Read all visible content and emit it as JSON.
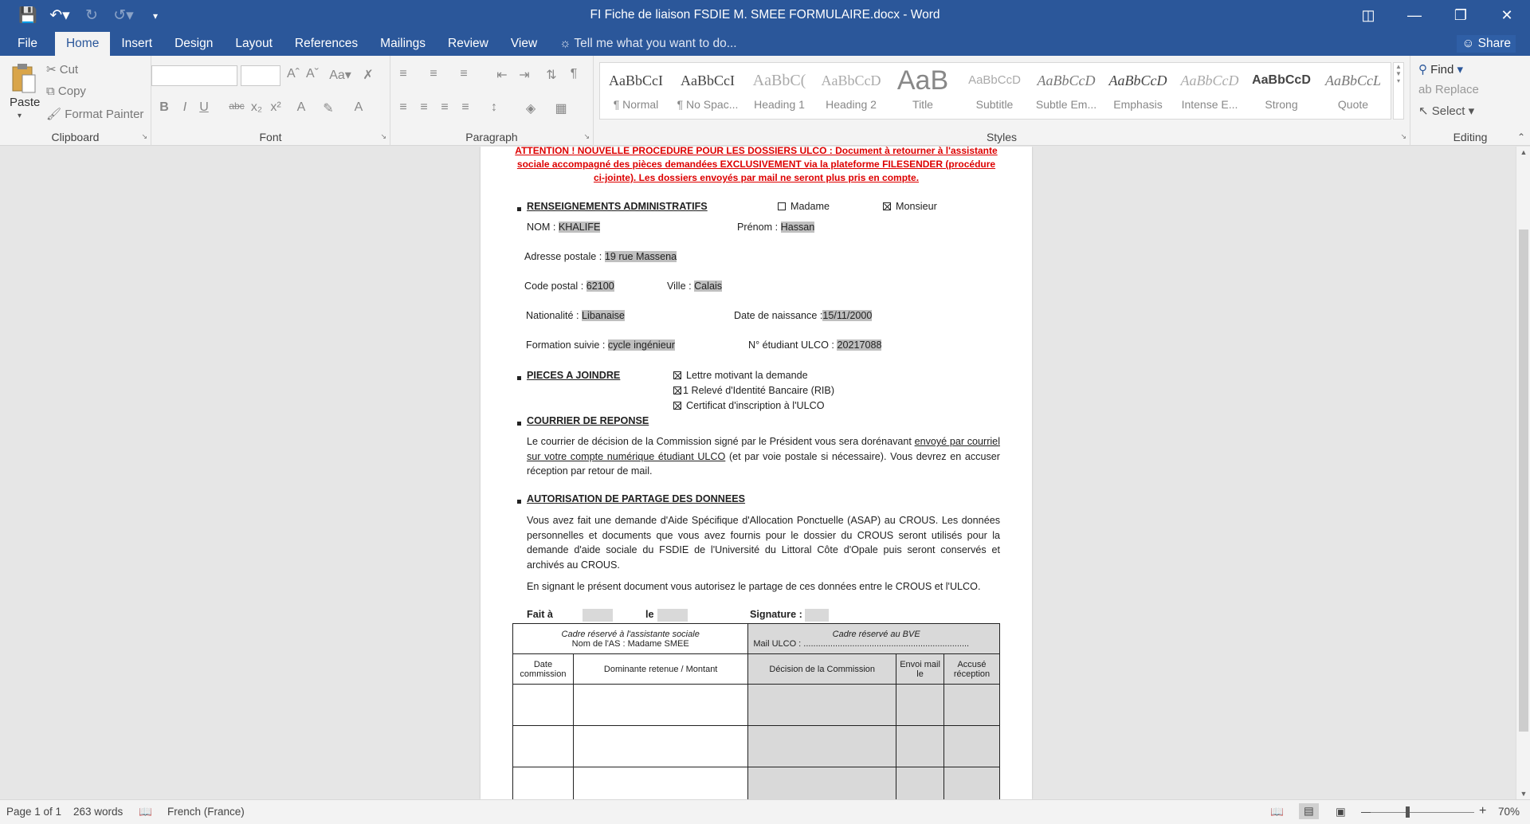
{
  "qat": {
    "save_icon": "save-icon",
    "undo_icon": "undo-icon",
    "redo_icon": "redo-icon",
    "customize_icon": "customize-qat-icon"
  },
  "window": {
    "title": "FI Fiche de liaison FSDIE M. SMEE FORMULAIRE.docx - Word"
  },
  "tabs": [
    "File",
    "Home",
    "Insert",
    "Design",
    "Layout",
    "References",
    "Mailings",
    "Review",
    "View"
  ],
  "active_tab": "Home",
  "tellme": "Tell me what you want to do...",
  "share": "Share",
  "clipboard": {
    "paste": "Paste",
    "cut": "Cut",
    "copy": "Copy",
    "format_painter": "Format Painter",
    "label": "Clipboard"
  },
  "font": {
    "label": "Font"
  },
  "paragraph": {
    "label": "Paragraph"
  },
  "styles": {
    "label": "Styles",
    "items": [
      {
        "preview": "AaBbCcI",
        "name": "¶ Normal"
      },
      {
        "preview": "AaBbCcI",
        "name": "¶ No Spac..."
      },
      {
        "preview": "AaBbC(",
        "name": "Heading 1"
      },
      {
        "preview": "AaBbCcD",
        "name": "Heading 2"
      },
      {
        "preview": "AaB",
        "name": "Title"
      },
      {
        "preview": "AaBbCcD",
        "name": "Subtitle"
      },
      {
        "preview": "AaBbCcD",
        "name": "Subtle Em..."
      },
      {
        "preview": "AaBbCcD",
        "name": "Emphasis"
      },
      {
        "preview": "AaBbCcD",
        "name": "Intense E..."
      },
      {
        "preview": "AaBbCcD",
        "name": "Strong"
      },
      {
        "preview": "AaBbCcL",
        "name": "Quote"
      }
    ]
  },
  "editing": {
    "find": "Find",
    "replace": "Replace",
    "select": "Select",
    "label": "Editing"
  },
  "doc": {
    "attention": "ATTENTION ! NOUVELLE PROCEDURE POUR LES DOSSIERS ULCO : Document à retourner à l'assistante sociale accompagné des pièces demandées EXCLUSIVEMENT via la plateforme FILESENDER (procédure ci-jointe). Les dossiers envoyés par mail ne seront plus pris en compte.",
    "sec1": "RENSEIGNEMENTS ADMINISTRATIFS",
    "madame": "Madame",
    "monsieur": "Monsieur",
    "nom_label": "NOM : ",
    "nom": "KHALIFE",
    "prenom_label": "Prénom : ",
    "prenom": "Hassan",
    "adresse_label": "Adresse postale : ",
    "adresse": "19 rue Massena",
    "cp_label": "Code postal : ",
    "cp": "62100",
    "ville_label": "Ville : ",
    "ville": "Calais",
    "nat_label": "Nationalité : ",
    "nat": "Libanaise",
    "dob_label": "Date de naissance :",
    "dob": "15/11/2000",
    "formation_label": "Formation suivie : ",
    "formation": "cycle ingénieur",
    "etudiant_label": "N° étudiant ULCO : ",
    "etudiant": "20217088",
    "sec2": "PIECES A JOINDRE",
    "piece1": "Lettre motivant la demande",
    "piece2": "1 Relevé d'Identité Bancaire (RIB)",
    "piece3": "Certificat d'inscription à l'ULCO",
    "sec3": "COURRIER DE REPONSE",
    "courrier_a": "Le courrier de décision de la Commission signé par le Président vous sera dorénavant ",
    "courrier_u": "envoyé par courriel sur votre compte numérique étudiant ULCO",
    "courrier_b": " (et par voie postale si nécessaire). Vous devrez en accuser réception par retour de mail.",
    "sec4": "AUTORISATION DE PARTAGE DES DONNEES",
    "partage1": "Vous avez fait une demande d'Aide Spécifique d'Allocation Ponctuelle (ASAP) au CROUS. Les données personnelles et documents que vous avez fournis pour le dossier du CROUS seront utilisés pour la demande d'aide sociale du FSDIE de l'Université du Littoral Côte d'Opale puis seront conservés et archivés au CROUS.",
    "partage2": "En signant le présent document vous autorisez le partage de ces données entre le CROUS et l'ULCO.",
    "fait": "Fait à",
    "le": "le",
    "signature": "Signature :",
    "cadre_as": "Cadre réservé à l'assistante sociale",
    "nom_as": "Nom de l'AS : Madame SMEE",
    "cadre_bve": "Cadre réservé au BVE",
    "mail_ulco": "Mail ULCO : ....................................................................",
    "col1": "Date commission",
    "col2": "Dominante retenue / Montant",
    "col3": "Décision de la Commission",
    "col4": "Envoi mail le",
    "col5": "Accusé réception"
  },
  "status": {
    "page": "Page 1 of 1",
    "words": "263 words",
    "language": "French (France)",
    "zoom": "70%"
  }
}
